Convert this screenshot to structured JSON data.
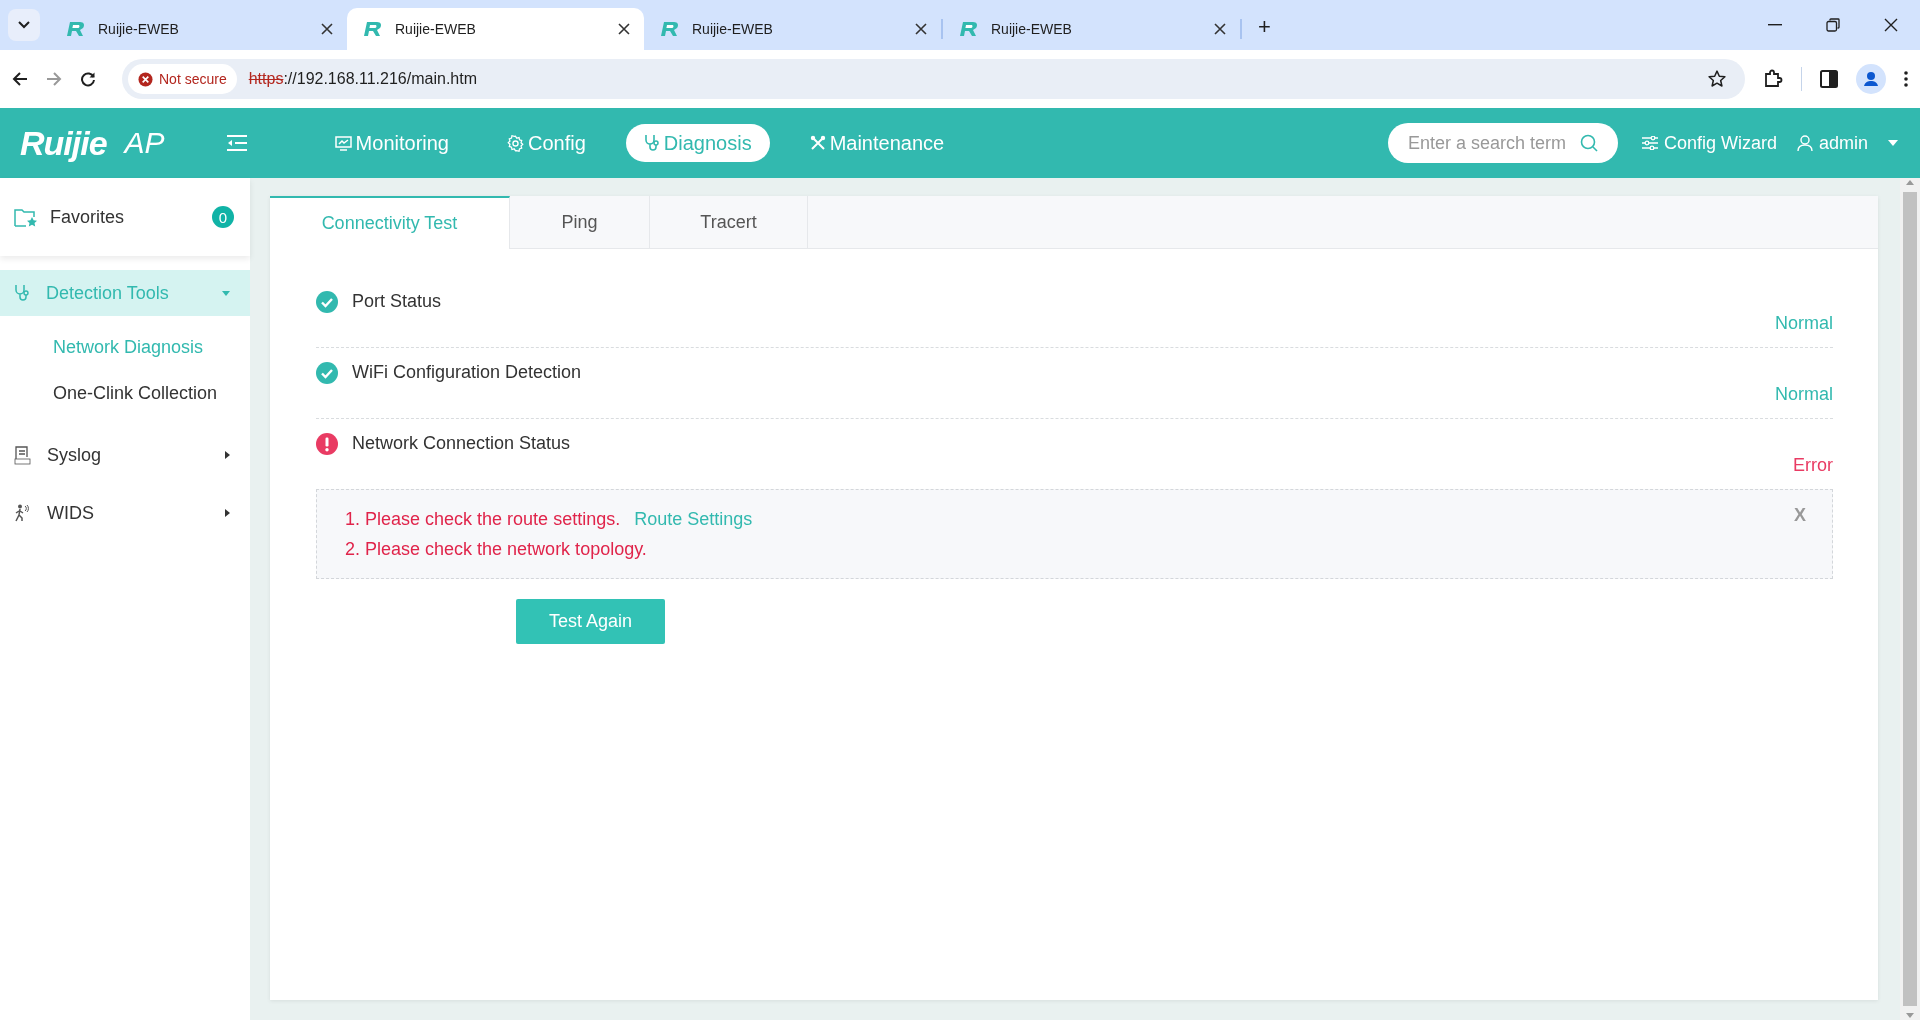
{
  "browser": {
    "tabs": [
      {
        "title": "Ruijie-EWEB",
        "selected": false
      },
      {
        "title": "Ruijie-EWEB",
        "selected": true
      },
      {
        "title": "Ruijie-EWEB",
        "selected": false
      },
      {
        "title": "Ruijie-EWEB",
        "selected": false
      }
    ],
    "new_tab": "+",
    "security": "Not secure",
    "scheme": "https",
    "address": "://192.168.11.216/main.htm"
  },
  "header": {
    "logo": "Ruijie",
    "product": "AP",
    "nav": [
      {
        "label": "Monitoring",
        "selected": false
      },
      {
        "label": "Config",
        "selected": false
      },
      {
        "label": "Diagnosis",
        "selected": true
      },
      {
        "label": "Maintenance",
        "selected": false
      }
    ],
    "search": {
      "placeholder": "Enter a search term"
    },
    "wizard": "Config Wizard",
    "user": "admin"
  },
  "sidebar": {
    "favorites": {
      "label": "Favorites",
      "count": "0"
    },
    "menu": [
      {
        "label": "Detection Tools",
        "expanded": true,
        "children": [
          {
            "label": "Network Diagnosis",
            "selected": true
          },
          {
            "label": "One-Clink Collection",
            "selected": false
          }
        ]
      },
      {
        "label": "Syslog",
        "expanded": false
      },
      {
        "label": "WIDS",
        "expanded": false
      }
    ]
  },
  "tabs": [
    {
      "label": "Connectivity Test",
      "selected": true
    },
    {
      "label": "Ping",
      "selected": false
    },
    {
      "label": "Tracert",
      "selected": false
    }
  ],
  "checks": [
    {
      "label": "Port Status",
      "passed": true,
      "result": "Normal"
    },
    {
      "label": "WiFi Configuration Detection",
      "passed": true,
      "result": "Normal"
    },
    {
      "label": "Network Connection Status",
      "passed": false,
      "result": "Error"
    }
  ],
  "advice": {
    "lines": [
      {
        "text": "1. Please check the route settings.",
        "link": "Route Settings"
      },
      {
        "text": "2. Please check the network topology."
      }
    ],
    "close": "X"
  },
  "button": "Test Again"
}
